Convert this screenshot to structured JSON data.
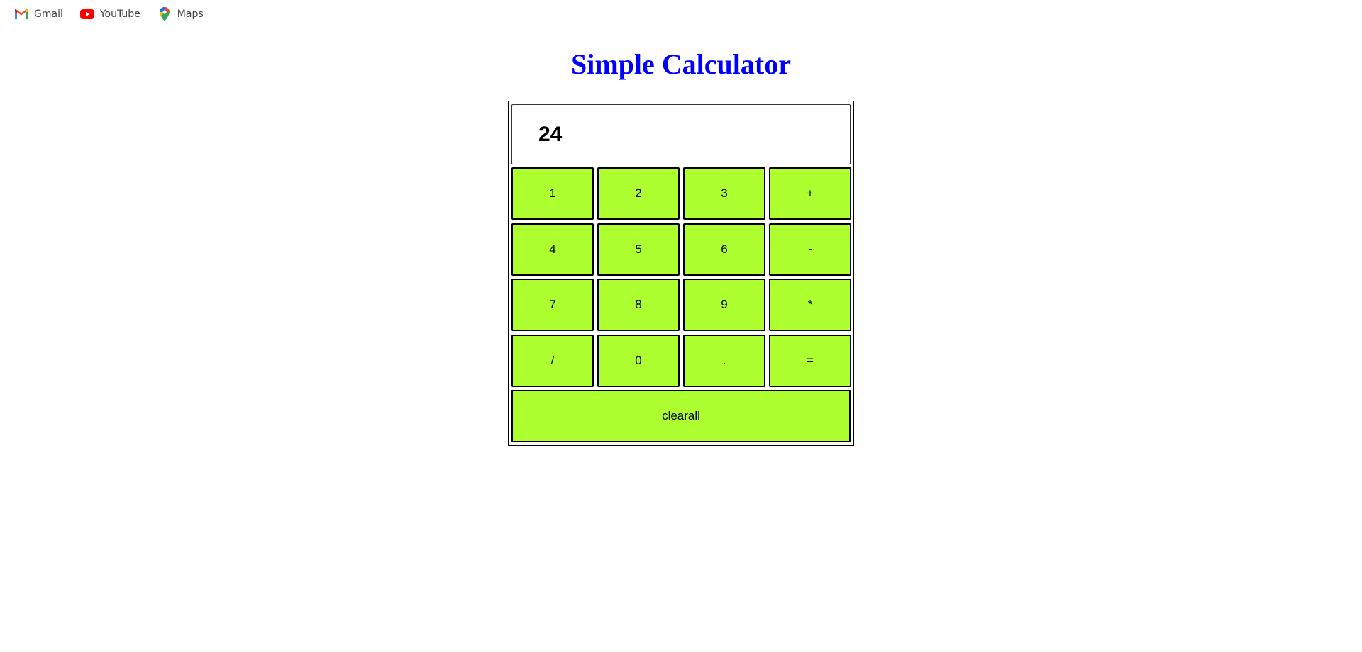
{
  "bookmarks": [
    {
      "label": "Gmail",
      "icon": "gmail-icon"
    },
    {
      "label": "YouTube",
      "icon": "youtube-icon"
    },
    {
      "label": "Maps",
      "icon": "maps-icon"
    }
  ],
  "page": {
    "title": "Simple Calculator",
    "title_color": "#0000ff"
  },
  "calculator": {
    "display_value": "24",
    "key_color": "#adff2f",
    "keys": {
      "k1": "1",
      "k2": "2",
      "k3": "3",
      "plus": "+",
      "k4": "4",
      "k5": "5",
      "k6": "6",
      "minus": "-",
      "k7": "7",
      "k8": "8",
      "k9": "9",
      "multiply": "*",
      "divide": "/",
      "k0": "0",
      "dot": ".",
      "equals": "=",
      "clear": "clearall"
    }
  }
}
